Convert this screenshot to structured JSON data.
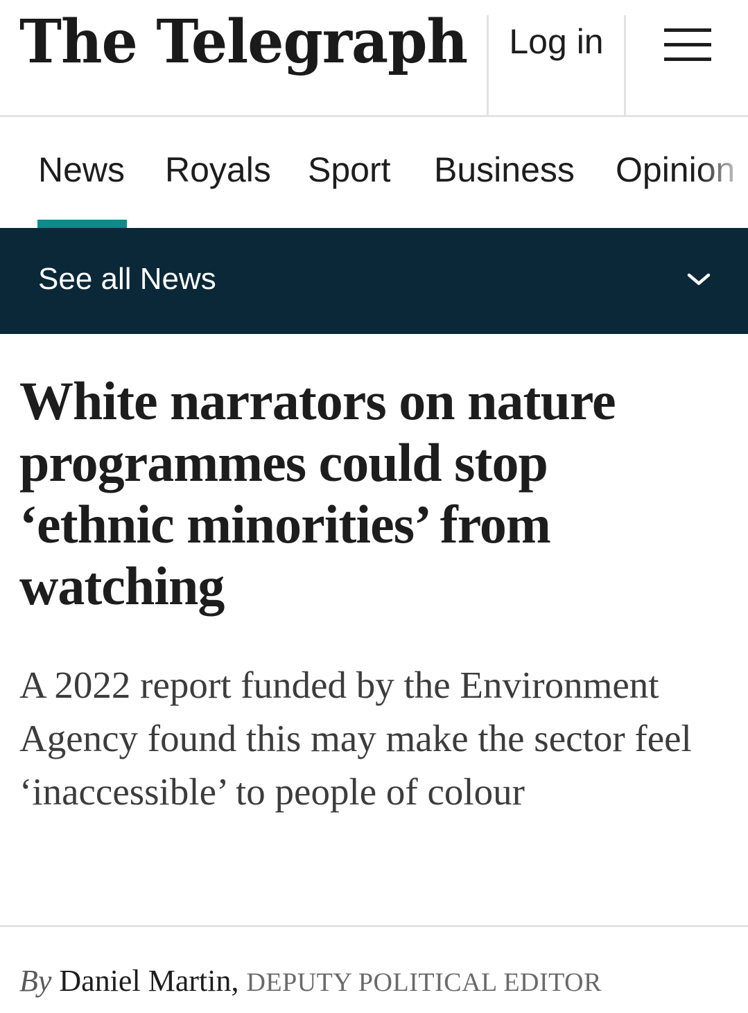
{
  "header": {
    "logo_text": "The Telegraph",
    "login_label": "Log in",
    "menu_icon": "hamburger-menu-icon"
  },
  "nav": {
    "items": [
      {
        "label": "News",
        "active": true
      },
      {
        "label": "Royals"
      },
      {
        "label": "Sport"
      },
      {
        "label": "Business"
      },
      {
        "label": "Opinion"
      }
    ],
    "accent_color": "#0f8a8a"
  },
  "subnav": {
    "label": "See all News",
    "icon": "chevron-down-icon",
    "background_color": "#0b2838"
  },
  "article": {
    "headline": "White narrators on nature programmes could stop ‘ethnic minorities’ from watching",
    "standfirst": "A 2022 report funded by the Environment Agency found this may make the sector feel ‘inaccessible’ to people of colour",
    "byline": {
      "prefix": "By",
      "author": "Daniel Martin,",
      "role": "DEPUTY POLITICAL EDITOR"
    }
  }
}
